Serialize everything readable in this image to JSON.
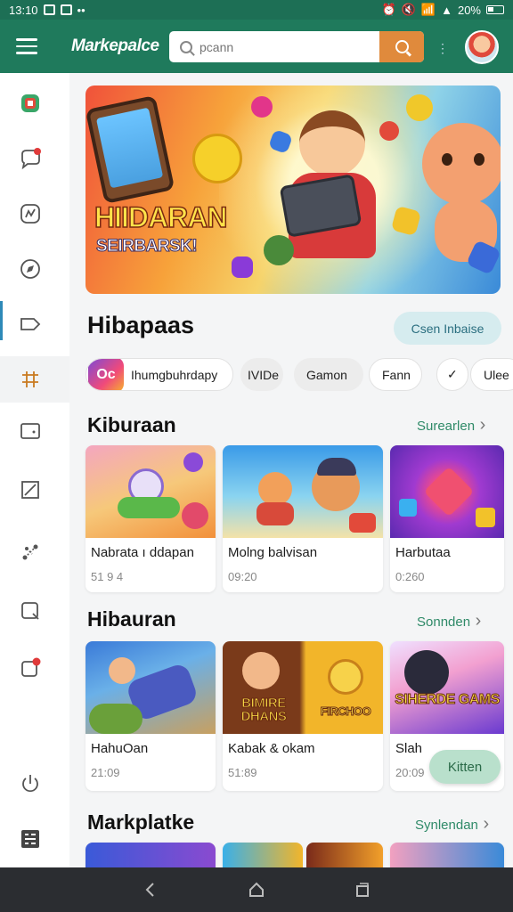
{
  "status_bar": {
    "time": "13:10",
    "battery_text": "20%"
  },
  "app_bar": {
    "title": "Markepalce",
    "search_placeholder": "pcann",
    "more_label": "⋮"
  },
  "hero": {
    "title": "HIIDARAN",
    "subtitle": "SEIRBARSK!"
  },
  "section": {
    "title": "Hibapaas",
    "see_all": "Csen Inbaise"
  },
  "chips": [
    {
      "label": "Ihumgbuhrdapy",
      "icon_text": "Oc"
    },
    {
      "label": "IVIDe"
    },
    {
      "label": "Gamon"
    },
    {
      "label": "Fann"
    },
    {
      "label": "✓"
    },
    {
      "label": "Ulee"
    }
  ],
  "row1": {
    "title": "Kiburaan",
    "link": "Surearlen",
    "cards": [
      {
        "name": "Nabrata ı ddapan",
        "meta": "51 9 4"
      },
      {
        "name": "Molng balvisan",
        "meta": "09:20"
      },
      {
        "name": "Harbutaa",
        "meta": "0:260"
      }
    ]
  },
  "row2": {
    "title": "Hibauran",
    "link": "Sonnden",
    "cards": [
      {
        "name": "HahuOan",
        "meta": "21:09"
      },
      {
        "name": "Kabak & okam",
        "meta": "51:89"
      },
      {
        "name": "Slah",
        "meta": "20:09"
      }
    ],
    "thumb_texts": [
      "BIMIRE DHANS",
      "FIRCHOO",
      "SIHERDE GAMS"
    ]
  },
  "row3": {
    "title": "Markplatke",
    "link": "Synlendan"
  },
  "fab": {
    "label": "Kitten"
  },
  "sidebar": {
    "items": [
      {
        "icon": "store-icon"
      },
      {
        "icon": "chat-icon"
      },
      {
        "icon": "analytics-icon"
      },
      {
        "icon": "compass-icon"
      },
      {
        "icon": "tag-icon"
      },
      {
        "icon": "grid-icon"
      },
      {
        "icon": "wallet-icon"
      },
      {
        "icon": "edit-icon"
      },
      {
        "icon": "share-icon"
      },
      {
        "icon": "bookmark-icon"
      },
      {
        "icon": "notification-icon"
      },
      {
        "icon": "power-icon"
      },
      {
        "icon": "qr-icon"
      }
    ]
  },
  "colors": {
    "app_bar": "#1f7a5c",
    "accent_orange": "#e08a3c",
    "link_green": "#2f8a68",
    "active_blue": "#2e8ab8"
  }
}
